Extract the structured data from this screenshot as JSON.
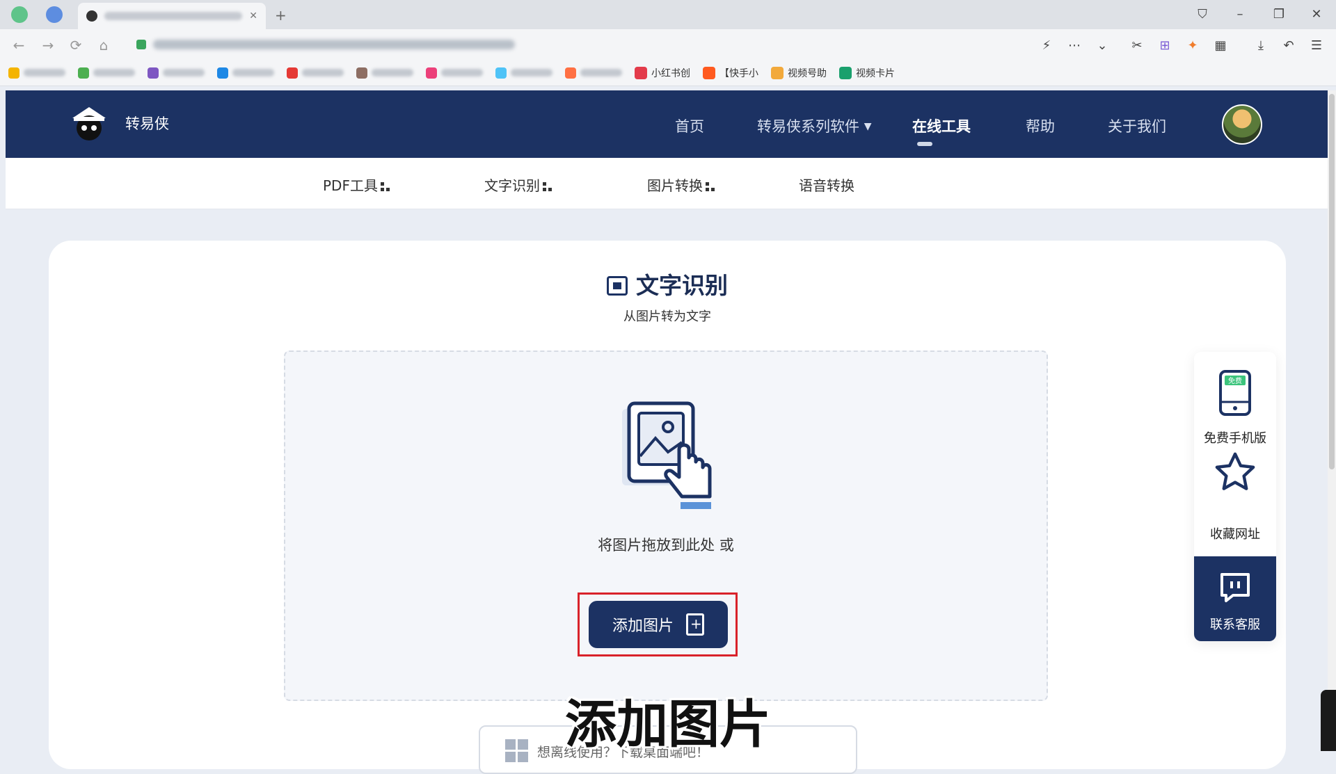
{
  "browser": {
    "bookmarks": [
      {
        "label": "小红书创",
        "color": "#e33b4b"
      },
      {
        "label": "【快手小",
        "color": "#ff5a1f"
      },
      {
        "label": "视频号助",
        "color": "#f2a93b"
      },
      {
        "label": "视频卡片",
        "color": "#1aa06d"
      }
    ]
  },
  "site": {
    "name": "转易侠",
    "nav": {
      "home": "首页",
      "series": "转易侠系列软件",
      "online_tools": "在线工具",
      "help": "帮助",
      "about": "关于我们"
    },
    "subnav": {
      "pdf": "PDF工具",
      "ocr": "文字识别",
      "image": "图片转换",
      "voice": "语音转换"
    }
  },
  "main": {
    "title": "文字识别",
    "subtitle": "从图片转为文字",
    "drop_hint": "将图片拖放到此处 或",
    "add_button": "添加图片",
    "download_text": "想离线使用？下载桌面端吧！"
  },
  "float_panel": {
    "mobile": "免费手机版",
    "mobile_badge": "免费",
    "bookmark": "收藏网址",
    "service": "联系客服"
  },
  "caption": "添加图片",
  "colors": {
    "brand": "#1c3263",
    "highlight": "#d9222a"
  }
}
